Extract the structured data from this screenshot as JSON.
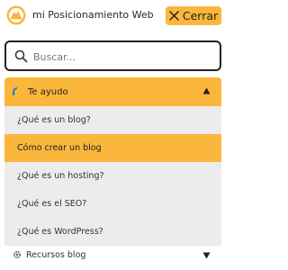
{
  "header": {
    "brand": "mi Posicionamiento Web",
    "close_label": "Cerrar",
    "accent": "#fbb73c"
  },
  "search": {
    "placeholder": "Buscar..."
  },
  "menu": {
    "section_title": "Te ayudo",
    "items": [
      {
        "label": "¿Qué es un blog?"
      },
      {
        "label": "Cómo crear un blog",
        "active": true
      },
      {
        "label": "¿Qué es un hosting?"
      },
      {
        "label": "¿Qué es el SEO?"
      },
      {
        "label": "¿Qué es WordPress?"
      }
    ],
    "second_section_title": "Recursos blog"
  }
}
